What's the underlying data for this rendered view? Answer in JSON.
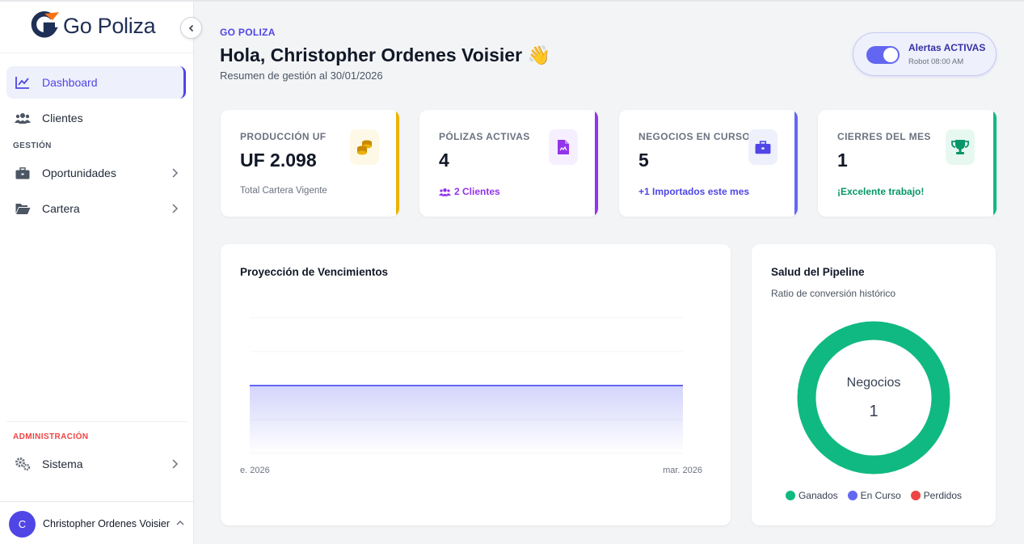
{
  "app": {
    "brand": "Go Poliza"
  },
  "sidebar": {
    "items": [
      {
        "label": "Dashboard",
        "icon": "chart-line-icon"
      },
      {
        "label": "Clientes",
        "icon": "users-icon"
      }
    ],
    "section_gestion": "GESTIÓN",
    "gestion_items": [
      {
        "label": "Oportunidades",
        "icon": "briefcase-icon"
      },
      {
        "label": "Cartera",
        "icon": "folder-open-icon"
      }
    ],
    "section_admin": "ADMINISTRACIÓN",
    "admin_items": [
      {
        "label": "Sistema",
        "icon": "cogs-icon"
      }
    ],
    "user": {
      "initial": "C",
      "name": "Christopher Ordenes Voisier"
    }
  },
  "header": {
    "kicker": "GO POLIZA",
    "greeting": "Hola, Christopher Ordenes Voisier 👋",
    "subtitle": "Resumen de gestión al 30/01/2026"
  },
  "alerts": {
    "title": "Alertas ACTIVAS",
    "subtitle": "Robot 08:00 AM",
    "enabled": true
  },
  "kpis": [
    {
      "label": "PRODUCCIÓN UF",
      "value": "UF 2.098",
      "foot": "Total Cartera Vigente",
      "icon": "coins-icon",
      "accent": "#eab308",
      "foot_color": "#6b7280"
    },
    {
      "label": "PÓLIZAS ACTIVAS",
      "value": "4",
      "foot": "2 Clientes",
      "icon": "file-contract-icon",
      "accent": "#9333ea",
      "foot_color": "#9333ea"
    },
    {
      "label": "NEGOCIOS EN CURSO",
      "value": "5",
      "foot": "+1 Importados este mes",
      "icon": "briefcase-icon",
      "accent": "#6366f1",
      "foot_color": "#4f46e5"
    },
    {
      "label": "CIERRES DEL MES",
      "value": "1",
      "foot": "¡Excelente trabajo!",
      "icon": "trophy-icon",
      "accent": "#10b981",
      "foot_color": "#059669"
    }
  ],
  "projection": {
    "title": "Proyección de Vencimientos",
    "x_start": "e. 2026",
    "x_end": "mar. 2026"
  },
  "pipeline": {
    "title": "Salud del Pipeline",
    "subtitle": "Ratio de conversión histórico",
    "center_label": "Negocios",
    "center_value": "1",
    "legend": [
      {
        "label": "Ganados",
        "color": "#10b981"
      },
      {
        "label": "En Curso",
        "color": "#6366f1"
      },
      {
        "label": "Perdidos",
        "color": "#ef4444"
      }
    ]
  },
  "chart_data": [
    {
      "type": "area",
      "title": "Proyección de Vencimientos",
      "x": [
        "e. 2026",
        "mar. 2026"
      ],
      "series": [
        {
          "values": [
            0,
            0
          ]
        }
      ]
    },
    {
      "type": "pie",
      "title": "Salud del Pipeline",
      "categories": [
        "Ganados",
        "En Curso",
        "Perdidos"
      ],
      "values": [
        1,
        0,
        0
      ],
      "colors": [
        "#10b981",
        "#6366f1",
        "#ef4444"
      ]
    }
  ]
}
